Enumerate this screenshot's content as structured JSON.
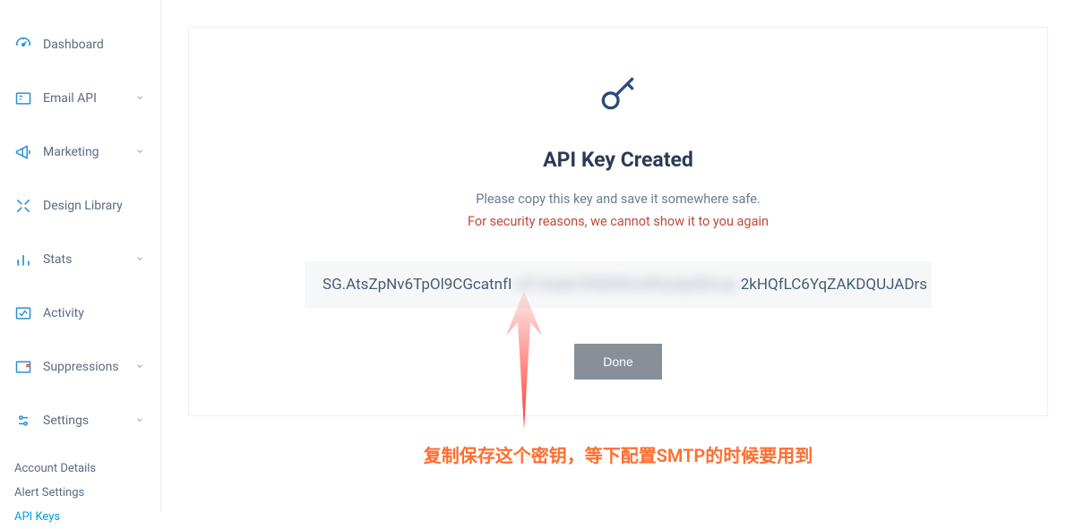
{
  "sidebar": {
    "items": [
      {
        "label": "Dashboard",
        "icon": "dashboard",
        "expandable": false
      },
      {
        "label": "Email API",
        "icon": "emailapi",
        "expandable": true
      },
      {
        "label": "Marketing",
        "icon": "marketing",
        "expandable": true
      },
      {
        "label": "Design Library",
        "icon": "design",
        "expandable": false
      },
      {
        "label": "Stats",
        "icon": "stats",
        "expandable": true
      },
      {
        "label": "Activity",
        "icon": "activity",
        "expandable": false
      },
      {
        "label": "Suppressions",
        "icon": "suppressions",
        "expandable": true
      },
      {
        "label": "Settings",
        "icon": "settings",
        "expandable": true
      }
    ],
    "sub_items": [
      {
        "label": "Account Details",
        "active": false
      },
      {
        "label": "Alert Settings",
        "active": false
      },
      {
        "label": "API Keys",
        "active": true
      }
    ]
  },
  "card": {
    "title": "API Key Created",
    "subtitle": "Please copy this key and save it somewhere safe.",
    "warning": "For security reasons, we cannot show it to you again",
    "api_key_prefix": "SG.AtsZpNv6TpOl9CGcatnfI",
    "api_key_blur": "xPvSabC0lk89DstRtyQpMnop",
    "api_key_suffix": "2kHQfLC6YqZAKDQUJADrs",
    "done_label": "Done"
  },
  "annotation": {
    "text": "复制保存这个密钥，等下配置SMTP的时候要用到"
  }
}
